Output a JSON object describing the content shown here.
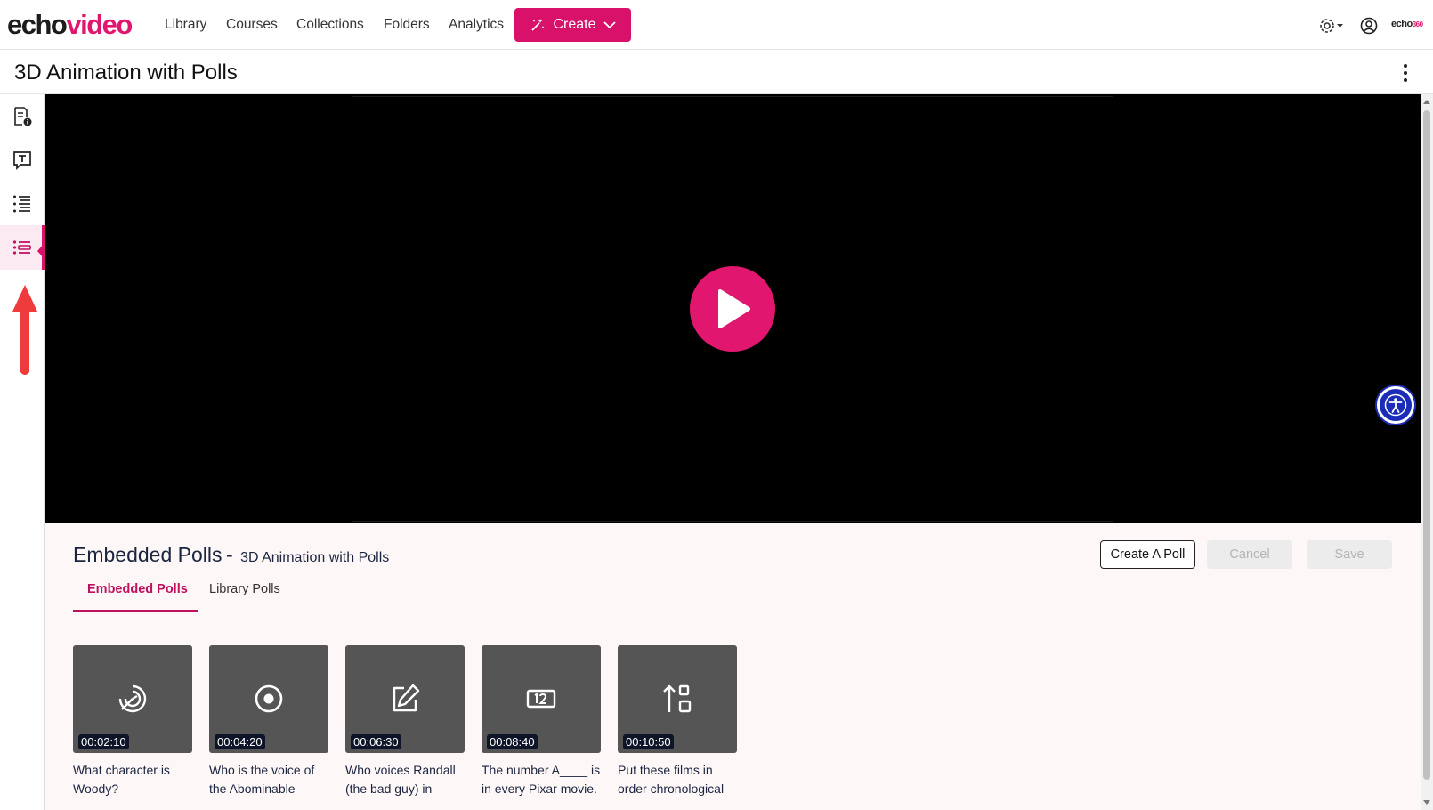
{
  "app": {
    "logo_part1": "echo",
    "logo_part2": "video",
    "brand_small_main": "echo",
    "brand_small_suffix": "360",
    "accent_color": "#d8126b"
  },
  "nav": {
    "links": [
      "Library",
      "Courses",
      "Collections",
      "Folders",
      "Analytics"
    ],
    "create_label": "Create",
    "icons": [
      "settings-icon",
      "user-icon"
    ]
  },
  "page": {
    "title": "3D Animation with Polls"
  },
  "rail": {
    "items": [
      "details-icon",
      "transcript-icon",
      "chapters-icon",
      "polls-icon"
    ],
    "active": "polls-icon"
  },
  "polls_panel": {
    "title": "Embedded Polls",
    "separator": "-",
    "subtitle": "3D Animation with Polls",
    "buttons": {
      "create": "Create A Poll",
      "cancel": "Cancel",
      "save": "Save"
    },
    "tabs": [
      {
        "label": "Embedded Polls",
        "active": true
      },
      {
        "label": "Library Polls",
        "active": false
      }
    ],
    "polls": [
      {
        "time": "00:02:10",
        "text": "What character is Woody?",
        "icon": "target-icon"
      },
      {
        "time": "00:04:20",
        "text": "Who is the voice of the Abominable",
        "icon": "radio-icon"
      },
      {
        "time": "00:06:30",
        "text": "Who voices Randall (the bad guy) in",
        "icon": "edit-icon"
      },
      {
        "time": "00:08:40",
        "text": "The number A____ is in every Pixar movie.",
        "icon": "number-icon"
      },
      {
        "time": "00:10:50",
        "text": "Put these films in order chronological",
        "icon": "order-icon"
      }
    ]
  }
}
